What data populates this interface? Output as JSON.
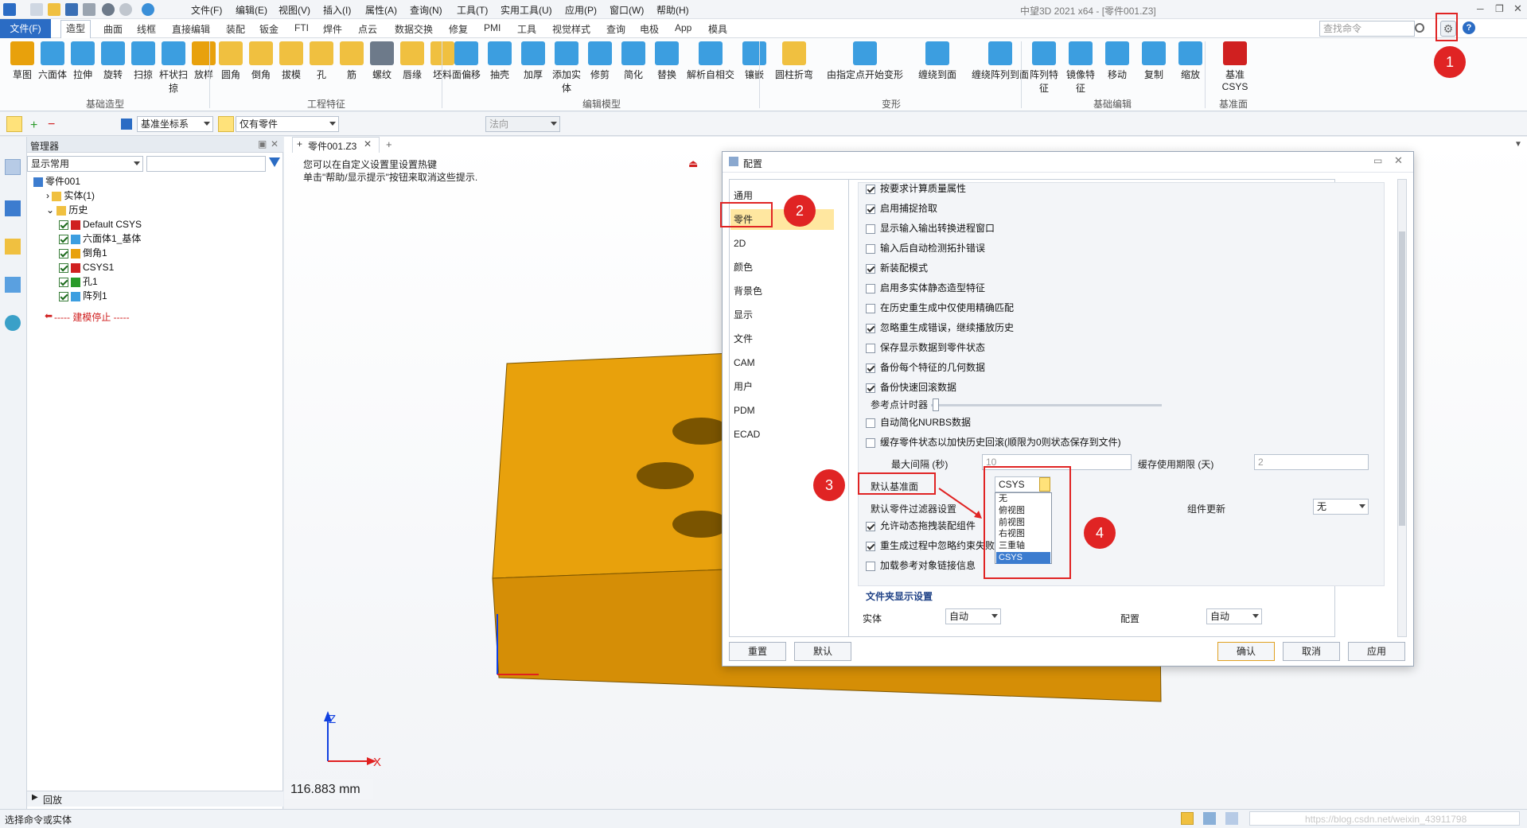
{
  "window": {
    "title": "中望3D 2021 x64 - [零件001.Z3]",
    "search_placeholder": "查找命令"
  },
  "menu": [
    "文件(F)",
    "编辑(E)",
    "视图(V)",
    "插入(I)",
    "属性(A)",
    "查询(N)",
    "工具(T)",
    "实用工具(U)",
    "应用(P)",
    "窗口(W)",
    "帮助(H)"
  ],
  "tabs": [
    "文件(F)",
    "造型",
    "曲面",
    "线框",
    "直接编辑",
    "装配",
    "钣金",
    "FTI",
    "焊件",
    "点云",
    "数据交换",
    "修复",
    "PMI",
    "工具",
    "视觉样式",
    "查询",
    "电极",
    "App",
    "模具"
  ],
  "ribbon": {
    "basic": {
      "label": "基础造型",
      "buttons": [
        "草图",
        "六面体",
        "拉伸",
        "旋转",
        "扫掠",
        "杆状扫掠",
        "放样"
      ]
    },
    "eng": {
      "label": "工程特征",
      "buttons": [
        "圆角",
        "倒角",
        "拔模",
        "孔",
        "筋",
        "螺纹",
        "唇缘",
        "坯料"
      ]
    },
    "edit": {
      "label": "编辑模型",
      "buttons": [
        "面偏移",
        "抽壳",
        "加厚",
        "添加实体",
        "修剪",
        "简化",
        "替换",
        "解析自相交",
        "镶嵌"
      ]
    },
    "deform": {
      "label": "变形",
      "buttons": [
        "圆柱折弯",
        "由指定点开始变形",
        "缠绕到面",
        "缠绕阵列到面"
      ]
    },
    "basic_edit": {
      "label": "基础编辑",
      "buttons": [
        "阵列特征",
        "镜像特征",
        "移动",
        "复制",
        "缩放"
      ]
    },
    "datum": {
      "label": "基准面",
      "buttons": [
        "基准CSYS"
      ]
    }
  },
  "toolbar2": {
    "coord": "基准坐标系",
    "filter": "仅有零件",
    "normal": "法向"
  },
  "manager": {
    "title": "管理器",
    "display_combo": "显示常用",
    "tree": [
      {
        "label": "零件001",
        "level": 0
      },
      {
        "label": "实体(1)",
        "level": 1
      },
      {
        "label": "历史",
        "level": 1
      },
      {
        "label": "Default CSYS",
        "level": 2
      },
      {
        "label": "六面体1_基体",
        "level": 2
      },
      {
        "label": "倒角1",
        "level": 2
      },
      {
        "label": "CSYS1",
        "level": 2
      },
      {
        "label": "孔1",
        "level": 2
      },
      {
        "label": "阵列1",
        "level": 2
      }
    ],
    "stop_label": "----- 建模停止 -----",
    "footer": "回放"
  },
  "viewport": {
    "doc_tab": "零件001.Z3",
    "hint1": "您可以在自定义设置里设置热键",
    "hint2": "单击\"帮助/显示提示\"按钮来取消这些提示.",
    "measure": "116.883 mm",
    "axis_x": "X",
    "axis_z": "Z"
  },
  "dialog": {
    "title": "配置",
    "nav": [
      "通用",
      "零件",
      "2D",
      "颜色",
      "背景色",
      "显示",
      "文件",
      "CAM",
      "用户",
      "PDM",
      "ECAD"
    ],
    "selected_nav": "零件",
    "options": [
      {
        "label": "按要求计算质量属性",
        "checked": true
      },
      {
        "label": "启用捕捉拾取",
        "checked": true
      },
      {
        "label": "显示输入输出转换进程窗口",
        "checked": false
      },
      {
        "label": "输入后自动检测拓扑错误",
        "checked": false
      },
      {
        "label": "新装配模式",
        "checked": true
      },
      {
        "label": "启用多实体静态造型特征",
        "checked": false
      },
      {
        "label": "在历史重生成中仅使用精确匹配",
        "checked": false
      },
      {
        "label": "忽略重生成错误，继续播放历史",
        "checked": true
      },
      {
        "label": "保存显示数据到零件状态",
        "checked": false
      },
      {
        "label": "备份每个特征的几何数据",
        "checked": true
      },
      {
        "label": "备份快速回滚数据",
        "checked": true
      }
    ],
    "ref_timer": "参考点计时器",
    "opts2": [
      {
        "label": "自动简化NURBS数据",
        "checked": false
      },
      {
        "label": "缓存零件状态以加快历史回滚(顺限为0则状态保存到文件)",
        "checked": false
      }
    ],
    "max_interval_label": "最大间隔 (秒)",
    "max_interval_value": "10",
    "cache_label": "缓存使用期限 (天)",
    "cache_value": "2",
    "default_datum_label": "默认基准面",
    "default_datum_value": "CSYS",
    "datum_options": [
      "无",
      "俯视图",
      "前视图",
      "右视图",
      "三重轴",
      "CSYS"
    ],
    "filter_label": "默认零件过滤器设置",
    "assembly_update_label": "组件更新",
    "assembly_update_value": "无",
    "opts3": [
      {
        "label": "允许动态拖拽装配组件",
        "checked": true
      },
      {
        "label": "重生成过程中忽略约束失败",
        "checked": true
      },
      {
        "label": "加载参考对象链接信息",
        "checked": false
      }
    ],
    "folder_section": "文件夹显示设置",
    "solid_label": "实体",
    "solid_value": "自动",
    "config_label": "配置",
    "config_value": "自动",
    "buttons": {
      "reset": "重置",
      "default": "默认",
      "ok": "确认",
      "cancel": "取消",
      "apply": "应用"
    }
  },
  "annotations": [
    "1",
    "2",
    "3",
    "4"
  ],
  "status": {
    "text": "选择命令或实体",
    "watermark": "https://blog.csdn.net/weixin_43911798"
  }
}
